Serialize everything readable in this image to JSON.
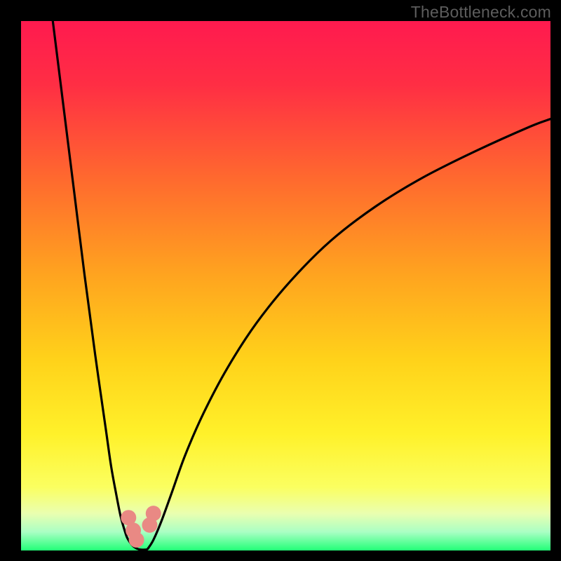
{
  "watermark": "TheBottleneck.com",
  "gradient_stops": [
    {
      "pct": 0,
      "color": "#ff1a4f"
    },
    {
      "pct": 12,
      "color": "#ff2e44"
    },
    {
      "pct": 30,
      "color": "#ff6a2e"
    },
    {
      "pct": 48,
      "color": "#ffa41f"
    },
    {
      "pct": 64,
      "color": "#ffd21a"
    },
    {
      "pct": 78,
      "color": "#fff12a"
    },
    {
      "pct": 88,
      "color": "#fbff60"
    },
    {
      "pct": 93,
      "color": "#eaffb0"
    },
    {
      "pct": 96.5,
      "color": "#aaffc4"
    },
    {
      "pct": 100,
      "color": "#22ff77"
    }
  ],
  "marker_color": "#e98984",
  "marker_radius": 11,
  "curve_stroke": "#000000",
  "curve_width": 3.2,
  "chart_data": {
    "type": "line",
    "title": "",
    "xlabel": "",
    "ylabel": "",
    "xlim": [
      0,
      100
    ],
    "ylim": [
      0,
      100
    ],
    "series": [
      {
        "name": "left-curve",
        "x": [
          6.0,
          8.0,
          10.0,
          12.0,
          14.0,
          16.0,
          17.0,
          18.0,
          18.8,
          19.5,
          20.0,
          20.6,
          21.2,
          21.8
        ],
        "y": [
          100.0,
          84.0,
          68.0,
          52.0,
          37.0,
          23.0,
          16.0,
          10.5,
          6.5,
          4.0,
          2.5,
          1.5,
          0.8,
          0.4
        ]
      },
      {
        "name": "right-curve",
        "x": [
          24.0,
          25.0,
          26.5,
          28.5,
          31.0,
          34.5,
          39.0,
          44.5,
          51.0,
          58.5,
          67.0,
          76.0,
          86.0,
          96.0,
          100.0
        ],
        "y": [
          0.4,
          2.0,
          5.5,
          11.0,
          18.0,
          26.0,
          34.5,
          43.0,
          51.0,
          58.5,
          65.0,
          70.5,
          75.5,
          80.0,
          81.5
        ]
      }
    ],
    "floor": {
      "name": "valley-floor",
      "x": [
        21.8,
        22.3,
        22.8,
        23.3,
        23.8,
        24.0
      ],
      "y": [
        0.4,
        0.2,
        0.15,
        0.15,
        0.2,
        0.4
      ]
    },
    "markers": [
      {
        "series": "left-curve",
        "x": 20.3,
        "y": 6.2
      },
      {
        "series": "left-curve",
        "x": 21.2,
        "y": 3.8
      },
      {
        "series": "left-curve",
        "x": 21.8,
        "y": 2.0
      },
      {
        "series": "right-curve",
        "x": 24.3,
        "y": 4.8
      },
      {
        "series": "right-curve",
        "x": 25.0,
        "y": 7.0
      }
    ]
  }
}
